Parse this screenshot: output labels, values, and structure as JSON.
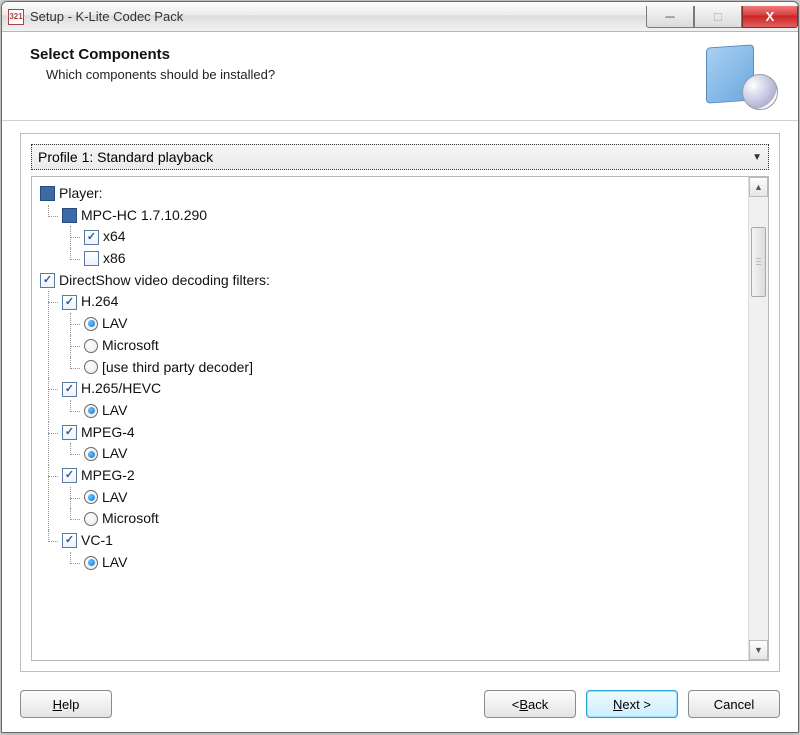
{
  "window": {
    "title": "Setup - K-Lite Codec Pack",
    "app_icon_text": "321"
  },
  "header": {
    "title": "Select Components",
    "subtitle": "Which components should be installed?"
  },
  "profile": {
    "selected": "Profile 1: Standard playback"
  },
  "tree": {
    "player_label": "Player:",
    "mpc_label": "MPC-HC 1.7.10.290",
    "x64_label": "x64",
    "x86_label": "x86",
    "ds_label": "DirectShow video decoding filters:",
    "h264_label": "H.264",
    "lav_label": "LAV",
    "microsoft_label": "Microsoft",
    "thirdparty_label": "[use third party decoder]",
    "h265_label": "H.265/HEVC",
    "mpeg4_label": "MPEG-4",
    "mpeg2_label": "MPEG-2",
    "vc1_label": "VC-1"
  },
  "footer": {
    "help": "Help",
    "back": "< Back",
    "next": "Next >",
    "cancel": "Cancel"
  }
}
